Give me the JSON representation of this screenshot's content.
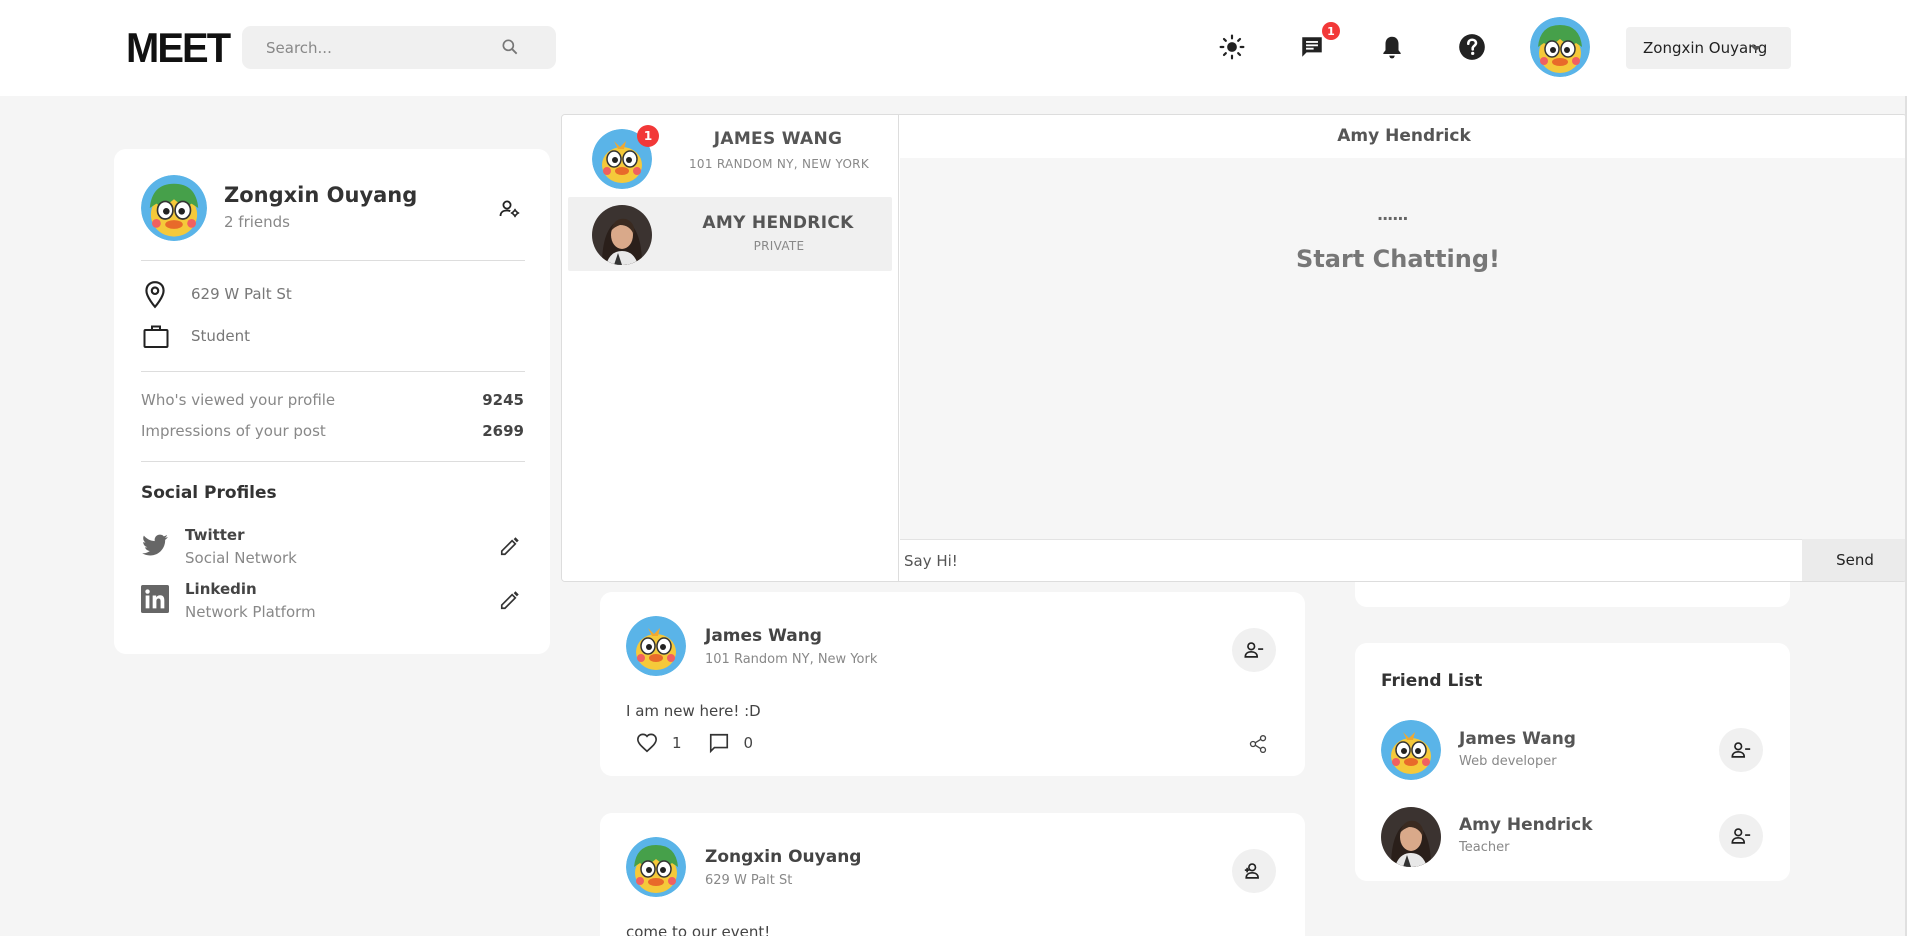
{
  "header": {
    "logo": "MEET",
    "search_placeholder": "Search...",
    "messages_badge": "1",
    "user_menu_label": "Zongxin Ouyang"
  },
  "profile": {
    "name": "Zongxin Ouyang",
    "friends": "2 friends",
    "location": "629 W Palt St",
    "occupation": "Student",
    "stats": [
      {
        "label": "Who's viewed your profile",
        "value": "9245"
      },
      {
        "label": "Impressions of your post",
        "value": "2699"
      }
    ],
    "social_title": "Social Profiles",
    "socials": [
      {
        "name": "Twitter",
        "sub": "Social Network",
        "icon": "twitter-icon"
      },
      {
        "name": "Linkedin",
        "sub": "Network Platform",
        "icon": "linkedin-icon"
      }
    ]
  },
  "chat": {
    "conversations": [
      {
        "name": "JAMES WANG",
        "sub": "101 RANDOM NY, NEW YORK",
        "badge": "1"
      },
      {
        "name": "AMY HENDRICK",
        "sub": "PRIVATE"
      }
    ],
    "active_name": "Amy Hendrick",
    "dots": "......",
    "empty_title": "Start Chatting!",
    "input_placeholder": "Say Hi!",
    "send_label": "Send"
  },
  "posts": [
    {
      "name": "James Wang",
      "location": "101 Random NY, New York",
      "text": "I am new here! :D",
      "likes": "1",
      "comments": "0",
      "action": "remove-friend"
    },
    {
      "name": "Zongxin Ouyang",
      "location": "629 W Palt St",
      "text": "come to our event!",
      "action": "add-friend"
    }
  ],
  "friend_list": {
    "title": "Friend List",
    "friends": [
      {
        "name": "James Wang",
        "sub": "Web developer"
      },
      {
        "name": "Amy Hendrick",
        "sub": "Teacher"
      }
    ]
  },
  "colors": {
    "badge": "#f23838",
    "background": "#f5f5f5",
    "card": "#ffffff"
  }
}
